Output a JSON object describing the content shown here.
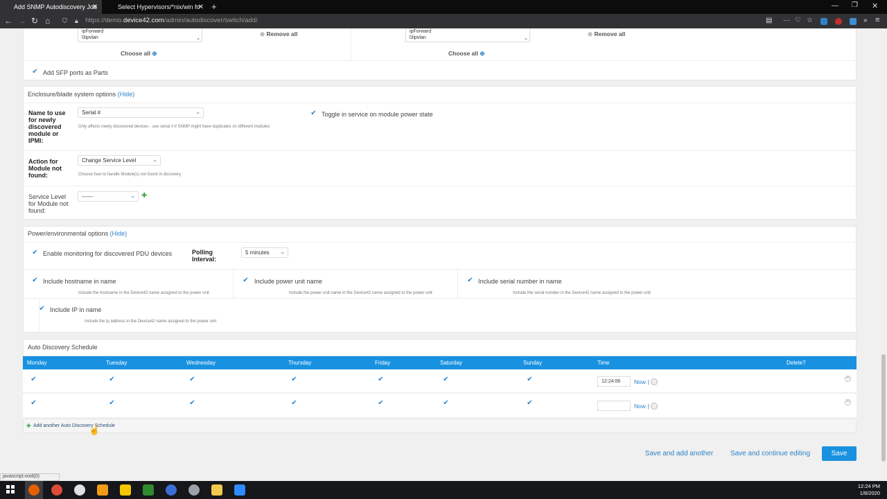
{
  "browser": {
    "tabs": [
      {
        "title": "Add SNMP Autodiscovery Job",
        "active": true
      },
      {
        "title": "Select Hypervisors/*nix/win fo",
        "active": false
      }
    ],
    "url_prefix": "https://demo.",
    "url_host": "device42.com",
    "url_path": "/admin/autodiscover/switch/add/"
  },
  "top_section": {
    "left_list": [
      "ipForward",
      "l3ipvlan"
    ],
    "right_list": [
      "ipForward",
      "l3ipvlan"
    ],
    "remove_all": "Remove all",
    "choose_all": "Choose all",
    "add_sfp": "Add SFP ports as Parts"
  },
  "enclosure": {
    "title": "Enclosure/blade system options",
    "hide": "(Hide)",
    "name_label": "Name to use for newly discovered module or IPMI:",
    "name_value": "Serial #",
    "name_hint": "Only affects newly discovered devices - use serial # if SNMP might have duplicates on different modules",
    "toggle_label": "Toggle in service on module power state",
    "action_label": "Action for Module not found:",
    "action_value": "Change Service Level",
    "action_hint": "Choose how to handle Module(s) not found in discovery",
    "service_label": "Service Level for Module not found:",
    "service_value": "------"
  },
  "power": {
    "title": "Power/environmental options",
    "hide": "(Hide)",
    "enable_pdu": "Enable monitoring for discovered PDU devices",
    "polling_label": "Polling Interval:",
    "polling_value": "5 minutes",
    "hostname_label": "Include hostname in name",
    "hostname_hint": "Include the hostname in the Device42 name assigned to the power unit",
    "powerunit_label": "Include power unit name",
    "powerunit_hint": "Include the power unit name in the Device42 name assigned to the power unit",
    "serial_label": "Include serial number in name",
    "serial_hint": "Include the serial number in the Device42 name assigned to the power unit",
    "ip_label": "Include IP in name",
    "ip_hint": "Include the ip address in the Device42 name assigned to the power unit"
  },
  "schedule": {
    "title": "Auto Discovery Schedule",
    "columns": [
      "Monday",
      "Tuesday",
      "Wednesday",
      "Thursday",
      "Friday",
      "Saturday",
      "Sunday",
      "Time",
      "Delete?"
    ],
    "rows": [
      {
        "time": "12:24:06",
        "now": "Now |"
      },
      {
        "time": "",
        "now": "Now |"
      }
    ],
    "add_another": "Add another Auto Discovery Schedule"
  },
  "actions": {
    "save_add": "Save and add another",
    "save_continue": "Save and continue editing",
    "save": "Save"
  },
  "status_text": "javascript:void(0)",
  "clock": {
    "time": "12:24 PM",
    "date": "1/8/2020"
  }
}
